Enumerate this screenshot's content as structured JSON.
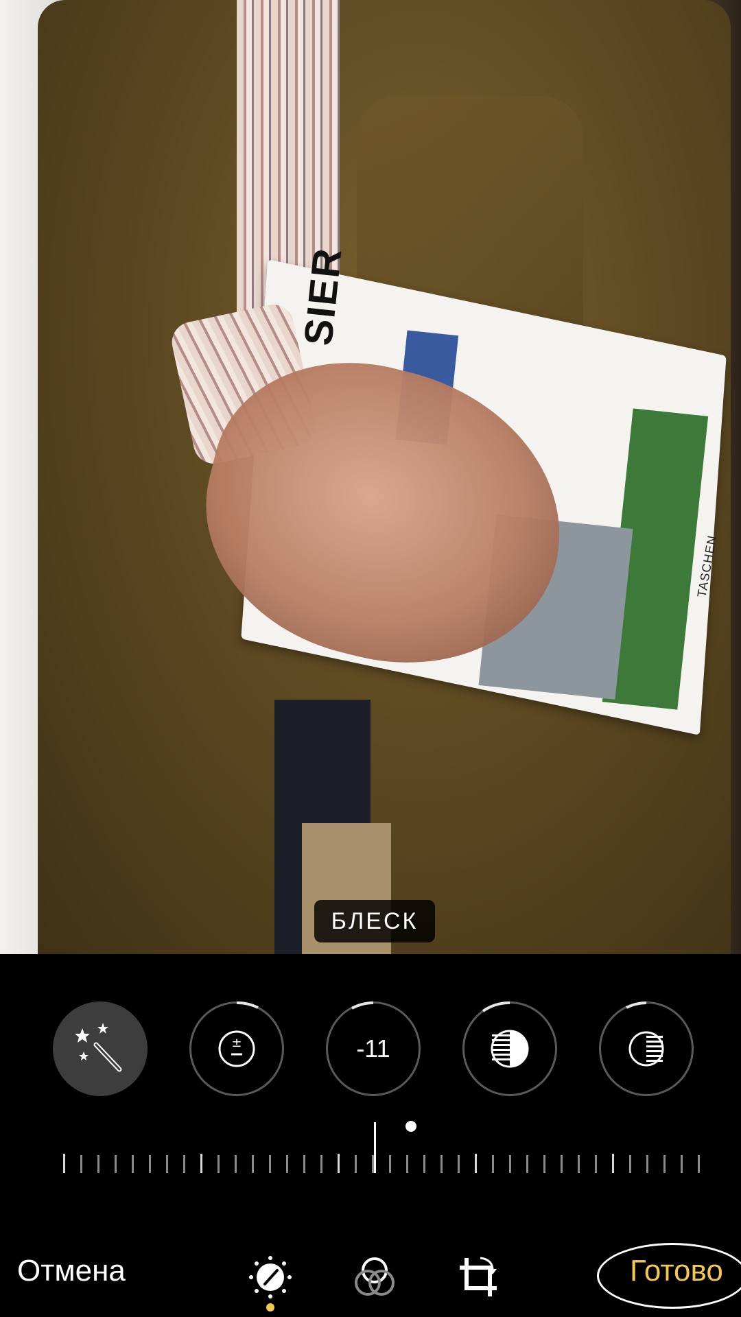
{
  "photo": {
    "book_title_text": "SIER",
    "book_brand_text": "TASCHEN"
  },
  "adjustment_label": "БЛЕСК",
  "dials": [
    {
      "name": "auto",
      "icon": "magic-wand-icon",
      "active": true
    },
    {
      "name": "exposure",
      "icon": "exposure-icon",
      "active": false
    },
    {
      "name": "brilliance",
      "value": "-11",
      "active": false
    },
    {
      "name": "highlights",
      "icon": "highlights-icon",
      "active": false
    },
    {
      "name": "shadows",
      "icon": "shadows-icon",
      "active": false
    }
  ],
  "slider": {
    "value": -11
  },
  "toolbar": {
    "cancel_label": "Отмена",
    "done_label": "Готово",
    "tabs": [
      {
        "name": "adjust",
        "icon": "adjust-dial-icon",
        "selected": true
      },
      {
        "name": "filters",
        "icon": "filters-icon",
        "selected": false
      },
      {
        "name": "crop",
        "icon": "crop-rotate-icon",
        "selected": false
      }
    ]
  },
  "colors": {
    "accent": "#f2c94c",
    "background": "#000000"
  }
}
